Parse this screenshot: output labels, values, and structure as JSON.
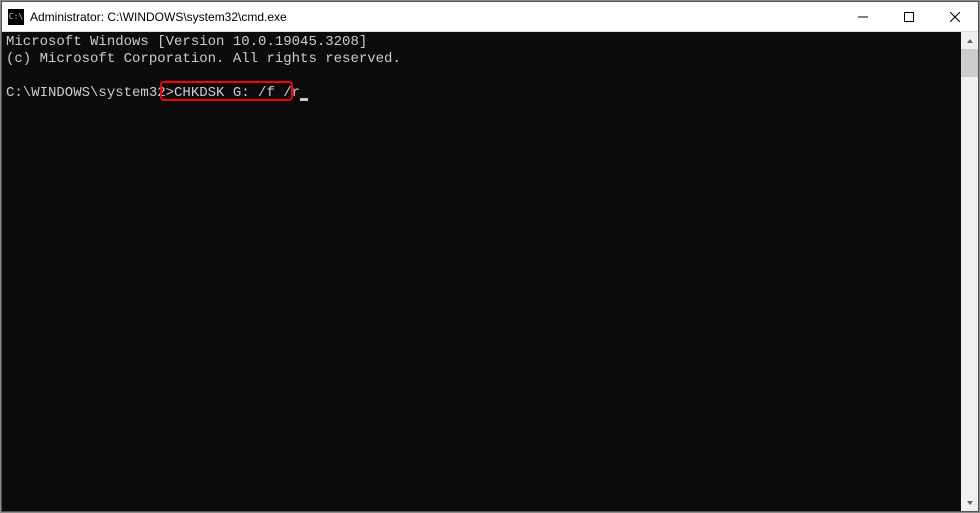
{
  "window": {
    "title": "Administrator: C:\\WINDOWS\\system32\\cmd.exe"
  },
  "terminal": {
    "line1": "Microsoft Windows [Version 10.0.19045.3208]",
    "line2": "(c) Microsoft Corporation. All rights reserved.",
    "blank": "",
    "prompt": "C:\\WINDOWS\\system32>",
    "command": "CHKDSK G: /f /r"
  },
  "icons": {
    "app": "C:\\",
    "minimize": "minimize",
    "maximize": "maximize",
    "close": "close",
    "scrollup": "up",
    "scrolldown": "down"
  }
}
